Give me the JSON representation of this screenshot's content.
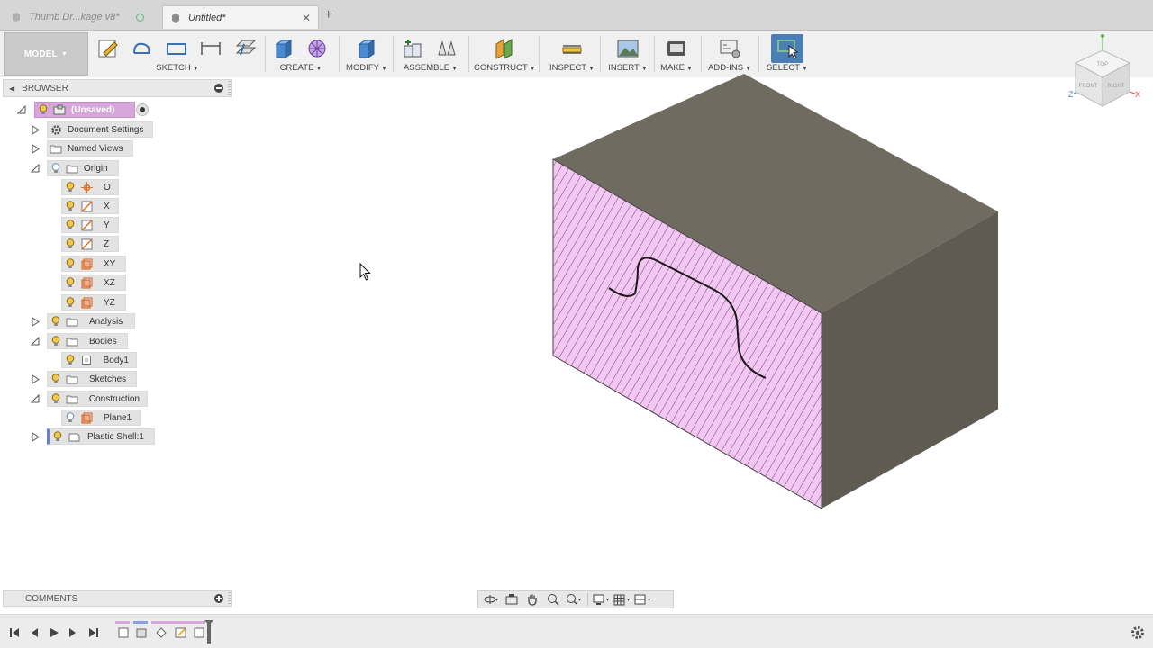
{
  "tabs": [
    {
      "title": "Thumb Dr...kage v8*",
      "active": false
    },
    {
      "title": "Untitled*",
      "active": true
    }
  ],
  "toolbar": {
    "workspace": "MODEL",
    "groups": [
      {
        "label": "SKETCH"
      },
      {
        "label": "CREATE"
      },
      {
        "label": "MODIFY"
      },
      {
        "label": "ASSEMBLE"
      },
      {
        "label": "CONSTRUCT"
      },
      {
        "label": "INSPECT"
      },
      {
        "label": "INSERT"
      },
      {
        "label": "MAKE"
      },
      {
        "label": "ADD-INS"
      },
      {
        "label": "SELECT"
      }
    ]
  },
  "browser": {
    "title": "BROWSER",
    "root": "(Unsaved)",
    "items": [
      {
        "label": "Document Settings"
      },
      {
        "label": "Named Views"
      },
      {
        "label": "Origin"
      },
      {
        "label": "O"
      },
      {
        "label": "X"
      },
      {
        "label": "Y"
      },
      {
        "label": "Z"
      },
      {
        "label": "XY"
      },
      {
        "label": "XZ"
      },
      {
        "label": "YZ"
      },
      {
        "label": "Analysis"
      },
      {
        "label": "Bodies"
      },
      {
        "label": "Body1"
      },
      {
        "label": "Sketches"
      },
      {
        "label": "Construction"
      },
      {
        "label": "Plane1"
      },
      {
        "label": "Plastic Shell:1"
      }
    ]
  },
  "comments": {
    "title": "COMMENTS"
  },
  "viewcube": {
    "top": "TOP",
    "front": "FRONT",
    "right": "RIGHT",
    "axis_x": "X",
    "axis_y": "Y",
    "axis_z": "Z"
  },
  "colors": {
    "section_fill": "#f2c8f2",
    "hatch": "#7a3a7a",
    "body_top": "#6f6b60",
    "body_side": "#5f5b52",
    "accent": "#4a7fb5",
    "root_highlight": "#d7a6db"
  }
}
